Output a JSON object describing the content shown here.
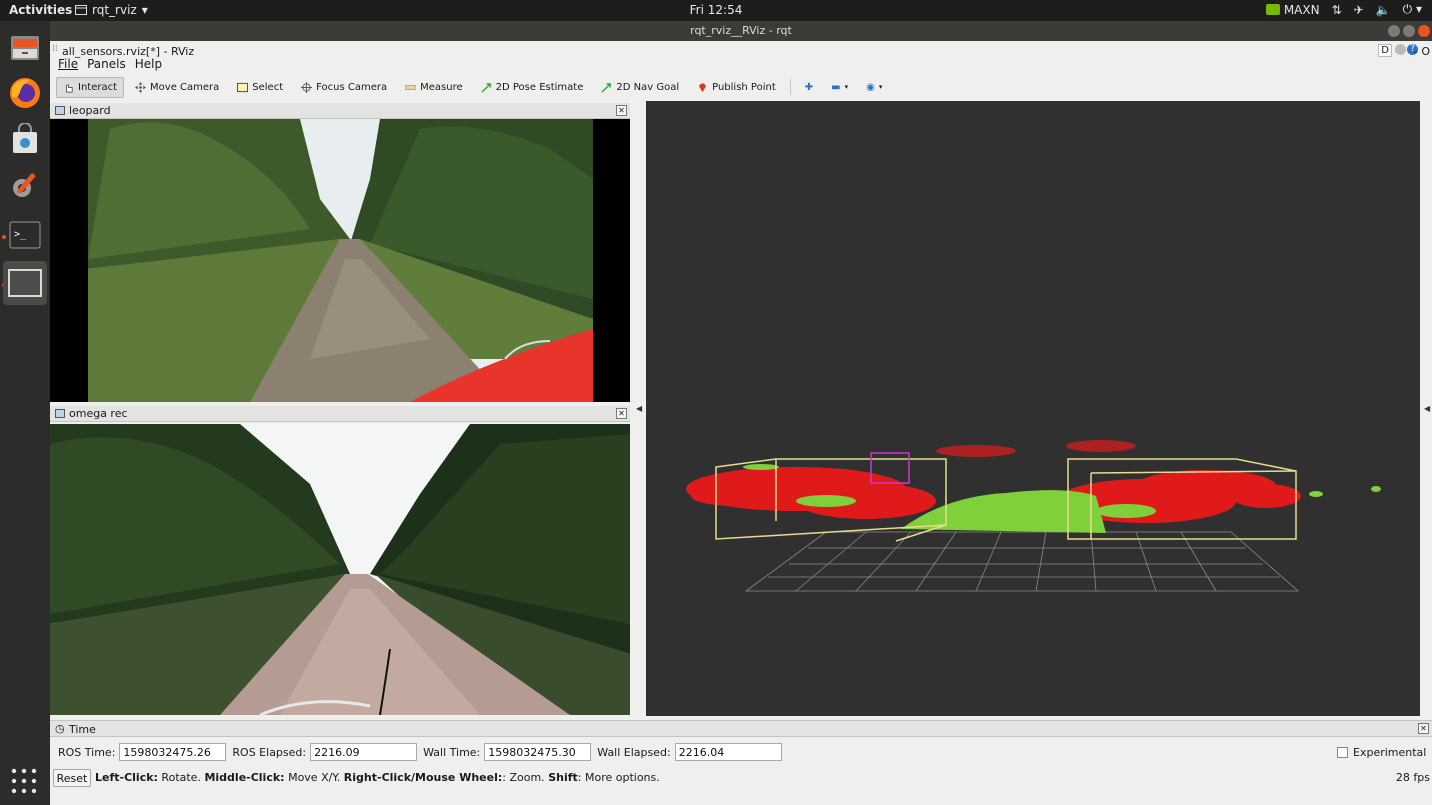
{
  "topbar": {
    "activities": "Activities",
    "app": "rqt_rviz",
    "clock": "Fri 12:54",
    "power_mode": "MAXN"
  },
  "window": {
    "title": "rqt_rviz__RViz - rqt",
    "rviz_title": "all_sensors.rviz[*] - RViz",
    "corner_label": "D",
    "corner_text": "- O"
  },
  "menu": {
    "file": "File",
    "panels": "Panels",
    "help": "Help"
  },
  "toolbar": {
    "interact": "Interact",
    "move_camera": "Move Camera",
    "select": "Select",
    "focus_camera": "Focus Camera",
    "measure": "Measure",
    "pose_estimate": "2D Pose Estimate",
    "nav_goal": "2D Nav Goal",
    "publish_point": "Publish Point"
  },
  "panels": {
    "top_title": "leopard",
    "bottom_title": "omega rec"
  },
  "time": {
    "title": "Time",
    "ros_time_label": "ROS Time:",
    "ros_time": "1598032475.26",
    "ros_elapsed_label": "ROS Elapsed:",
    "ros_elapsed": "2216.09",
    "wall_time_label": "Wall Time:",
    "wall_time": "1598032475.30",
    "wall_elapsed_label": "Wall Elapsed:",
    "wall_elapsed": "2216.04",
    "experimental": "Experimental"
  },
  "status": {
    "reset": "Reset",
    "left_click": "Left-Click:",
    "left_click_desc": " Rotate. ",
    "middle_click": "Middle-Click:",
    "middle_click_desc": " Move X/Y. ",
    "right_click": "Right-Click/Mouse Wheel:",
    "right_click_desc": ": Zoom. ",
    "shift": "Shift",
    "shift_desc": ": More options.",
    "fps": "28 fps"
  },
  "colors": {
    "ubuntu_orange": "#e95420",
    "view_bg": "#303030",
    "cloud_red": "#e01a1a",
    "cloud_green": "#7fd03a",
    "box_yellow": "#e8dc8c",
    "box_magenta": "#c838c8"
  }
}
